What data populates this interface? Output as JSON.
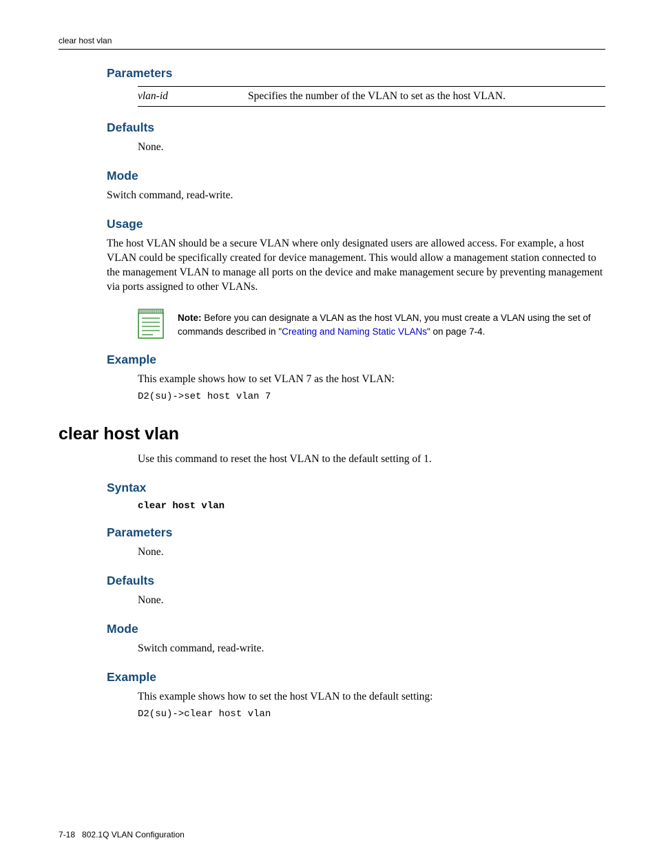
{
  "header": {
    "running_head": "clear host vlan"
  },
  "section1": {
    "h_parameters": "Parameters",
    "param_name": "vlan-id",
    "param_desc": "Specifies the number of the VLAN to set as the host VLAN.",
    "h_defaults": "Defaults",
    "defaults_text": "None.",
    "h_mode": "Mode",
    "mode_text": "Switch command, read-write.",
    "h_usage": "Usage",
    "usage_text": "The host VLAN should be a secure VLAN where only designated users are allowed access. For example, a host VLAN could be specifically created for device management. This would allow a management station connected to the management VLAN to manage all ports on the device and make management secure by preventing management via ports assigned to other VLANs.",
    "note_label": "Note:",
    "note_before": " Before you can designate a VLAN as the host VLAN, you must create a VLAN using the set of commands described in \"",
    "note_link": "Creating and Naming Static VLANs",
    "note_after": "\" on page 7-4.",
    "h_example": "Example",
    "example_text": "This example shows how to set VLAN 7 as the host VLAN:",
    "example_code": "D2(su)->set host vlan 7"
  },
  "section2": {
    "title": "clear host vlan",
    "intro": "Use this command to reset the host VLAN to the default setting of 1.",
    "h_syntax": "Syntax",
    "syntax_code": "clear host vlan",
    "h_parameters": "Parameters",
    "parameters_text": "None.",
    "h_defaults": "Defaults",
    "defaults_text": "None.",
    "h_mode": "Mode",
    "mode_text": "Switch command, read-write.",
    "h_example": "Example",
    "example_text": "This example shows how to set the host VLAN to the default setting:",
    "example_code": "D2(su)->clear host vlan"
  },
  "footer": {
    "page_num": "7-18",
    "chapter": "802.1Q VLAN Configuration"
  }
}
